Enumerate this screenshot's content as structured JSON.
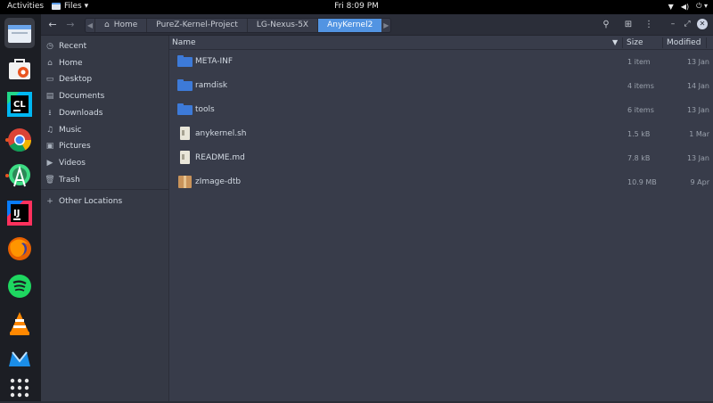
{
  "topbar": {
    "activities": "Activities",
    "app_name": "Files ▾",
    "clock": "Fri  8:09 PM",
    "sys_icons": [
      "wifi-icon",
      "volume-icon",
      "power-icon"
    ]
  },
  "dock": {
    "apps": [
      {
        "name": "files",
        "icon": "files-icon",
        "active": true
      },
      {
        "name": "ubuntu-software",
        "icon": "ubuntu-software-icon"
      },
      {
        "name": "clion",
        "icon": "clion-icon",
        "label": "CL"
      },
      {
        "name": "chrome",
        "icon": "chrome-icon"
      },
      {
        "name": "android-studio",
        "icon": "android-studio-icon"
      },
      {
        "name": "intellij",
        "icon": "intellij-icon",
        "label": "IJ"
      },
      {
        "name": "firefox",
        "icon": "firefox-icon"
      },
      {
        "name": "spotify",
        "icon": "spotify-icon"
      },
      {
        "name": "vlc",
        "icon": "vlc-icon"
      },
      {
        "name": "mailspring",
        "icon": "mailspring-icon"
      },
      {
        "name": "show-apps",
        "icon": "grid-icon"
      }
    ]
  },
  "pathbar": {
    "crumbs": [
      "Home",
      "PureZ-Kernel-Project",
      "LG-Nexus-5X",
      "AnyKernel2"
    ]
  },
  "sidebar": {
    "items": [
      {
        "label": "Recent",
        "icon": "clock-icon"
      },
      {
        "label": "Home",
        "icon": "home-icon"
      },
      {
        "label": "Desktop",
        "icon": "desktop-icon"
      },
      {
        "label": "Documents",
        "icon": "documents-icon"
      },
      {
        "label": "Downloads",
        "icon": "downloads-icon"
      },
      {
        "label": "Music",
        "icon": "music-icon"
      },
      {
        "label": "Pictures",
        "icon": "pictures-icon"
      },
      {
        "label": "Videos",
        "icon": "videos-icon"
      },
      {
        "label": "Trash",
        "icon": "trash-icon"
      }
    ],
    "other_locations": "Other Locations"
  },
  "columns": {
    "name": "Name",
    "size": "Size",
    "modified": "Modified"
  },
  "files": [
    {
      "name": "META-INF",
      "size": "1 item",
      "modified": "13 Jan",
      "type": "folder"
    },
    {
      "name": "ramdisk",
      "size": "4 items",
      "modified": "14 Jan",
      "type": "folder"
    },
    {
      "name": "tools",
      "size": "6 items",
      "modified": "13 Jan",
      "type": "folder"
    },
    {
      "name": "anykernel.sh",
      "size": "1.5 kB",
      "modified": "1 Mar",
      "type": "doc"
    },
    {
      "name": "README.md",
      "size": "7.8 kB",
      "modified": "13 Jan",
      "type": "doc"
    },
    {
      "name": "zImage-dtb",
      "size": "10.9 MB",
      "modified": "9 Apr",
      "type": "pkg"
    }
  ]
}
